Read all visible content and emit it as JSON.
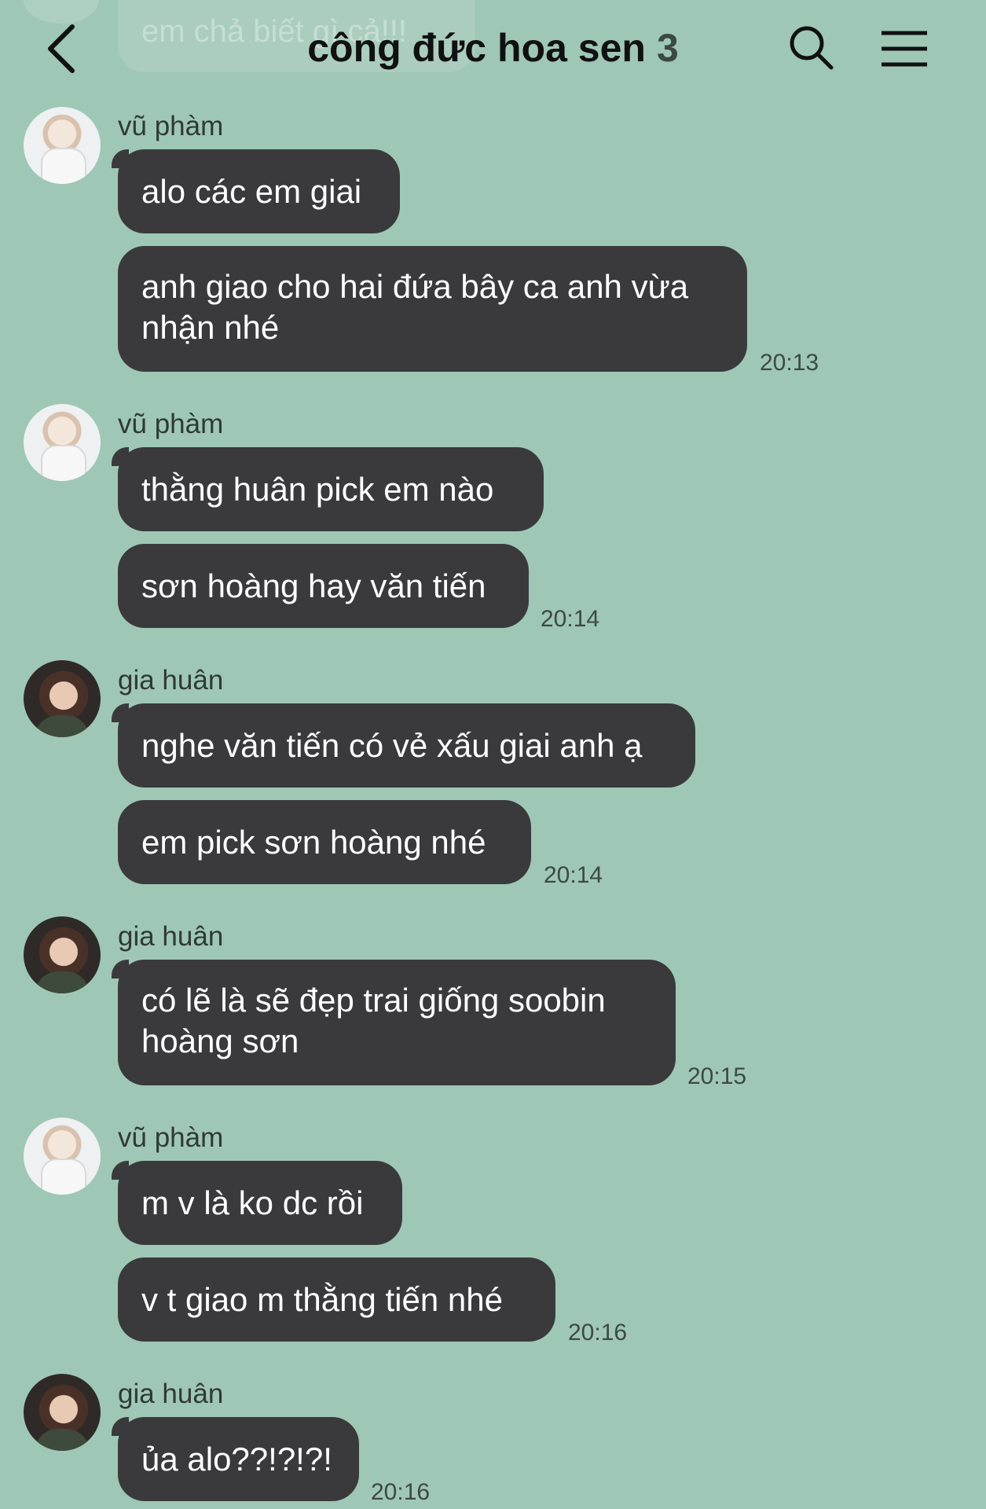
{
  "header": {
    "title": "công đức hoa sen",
    "member_count": "3",
    "prev_message_text": "em chả biết gì cả!!!"
  },
  "icons": {
    "back": "chevron-left-icon",
    "search": "search-icon",
    "menu": "hamburger-menu-icon"
  },
  "colors": {
    "background": "#9fc7b5",
    "bubble": "#3a3a3c",
    "bubble_text": "#ffffff",
    "timestamp": "#3c4a43"
  },
  "messages": [
    {
      "sender": "vũ phàm",
      "bubbles": [
        "alo các em giai",
        "anh giao cho hai đứa bây ca anh vừa nhận nhé"
      ],
      "time": "20:13"
    },
    {
      "sender": "vũ phàm",
      "bubbles": [
        "thằng huân pick em nào",
        "sơn hoàng hay văn tiến"
      ],
      "time": "20:14"
    },
    {
      "sender": "gia huân",
      "bubbles": [
        "nghe văn tiến có vẻ xấu giai anh ạ",
        "em pick sơn hoàng nhé"
      ],
      "time": "20:14"
    },
    {
      "sender": "gia huân",
      "bubbles": [
        "có lẽ là sẽ đẹp trai giống soobin hoàng sơn"
      ],
      "time": "20:15"
    },
    {
      "sender": "vũ phàm",
      "bubbles": [
        "m v là ko dc rồi",
        "v t giao m thằng tiến nhé"
      ],
      "time": "20:16"
    },
    {
      "sender": "gia huân",
      "bubbles": [
        "ủa alo??!?!?!"
      ],
      "time": "20:16"
    }
  ]
}
